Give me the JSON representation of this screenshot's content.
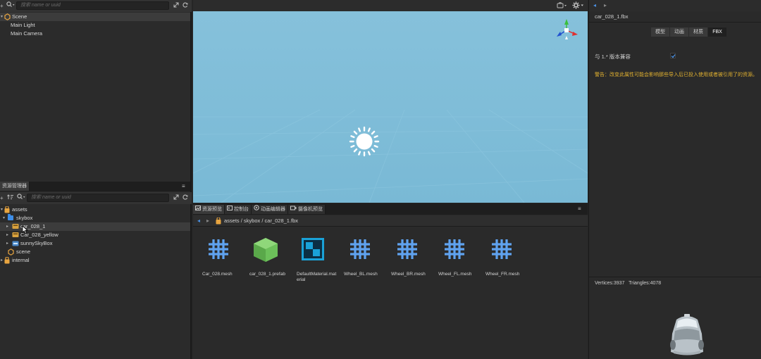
{
  "hierarchy": {
    "search_placeholder": "搜索 name or uuid",
    "items": [
      {
        "label": "Scene"
      },
      {
        "label": "Main Light"
      },
      {
        "label": "Main Camera"
      }
    ]
  },
  "assets_panel": {
    "tab_label": "资源管理器",
    "search_placeholder": "搜索 name or uuid",
    "tree": [
      {
        "label": "assets"
      },
      {
        "label": "skybox"
      },
      {
        "label": "car_028_1"
      },
      {
        "label": "Car_028_yellow"
      },
      {
        "label": "sunnySkyBox"
      },
      {
        "label": "scene"
      },
      {
        "label": "internal"
      }
    ]
  },
  "bottom_tabs": [
    {
      "label": "资源预览"
    },
    {
      "label": "控制台"
    },
    {
      "label": "动画编辑器"
    },
    {
      "label": "摄像机预览"
    }
  ],
  "breadcrumb": "assets / skybox / car_028_1.fbx",
  "assets_grid": [
    {
      "label": "Car_028.mesh",
      "icon": "mesh-icon"
    },
    {
      "label": "car_028_1.prefab",
      "icon": "prefab-icon"
    },
    {
      "label": "DefaultMaterial.material",
      "icon": "material-icon"
    },
    {
      "label": "Wheel_BL.mesh",
      "icon": "mesh-icon"
    },
    {
      "label": "Wheel_BR.mesh",
      "icon": "mesh-icon"
    },
    {
      "label": "Wheel_FL.mesh",
      "icon": "mesh-icon"
    },
    {
      "label": "Wheel_FR.mesh",
      "icon": "mesh-icon"
    }
  ],
  "inspector": {
    "title": "car_028_1.fbx",
    "tabs": [
      {
        "label": "模型"
      },
      {
        "label": "动画"
      },
      {
        "label": "材质"
      },
      {
        "label": "FBX"
      }
    ],
    "compat_label": "与 1.* 版本兼容",
    "compat_checked": true,
    "warning": "警告：改变此属性可能会影响那些导入后已投入使用或者被引用了的资源。",
    "stats": "Vertices:3937   Triangles:4078"
  },
  "colors": {
    "viewport_bg": "#7dbcd8",
    "accent_blue": "#4a8fe0",
    "folder_orange": "#e8a540",
    "warning_yellow": "#e0b030",
    "mesh_blue": "#5fa2ef",
    "prefab_green": "#6cc05a",
    "material_cyan": "#1aa2d8"
  }
}
